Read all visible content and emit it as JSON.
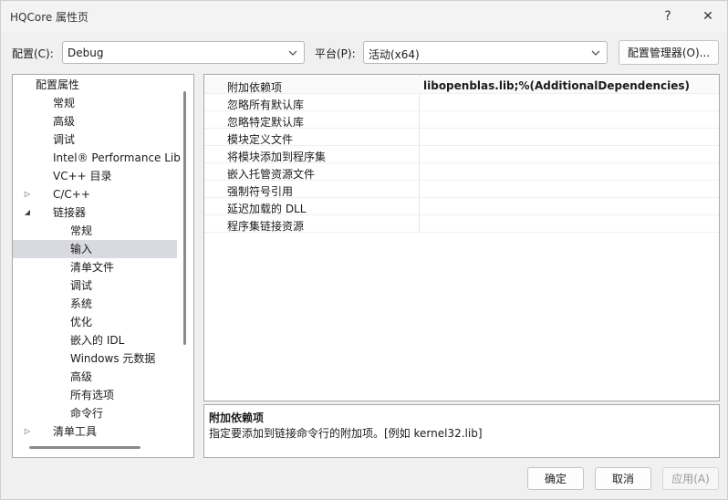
{
  "window": {
    "title": "HQCore 属性页"
  },
  "titlebar": {
    "help_glyph": "?",
    "close_glyph": "✕"
  },
  "config": {
    "label": "配置(C):",
    "value": "Debug",
    "platform_label": "平台(P):",
    "platform_value": "活动(x64)",
    "manager_button": "配置管理器(O)..."
  },
  "tree": {
    "items": [
      {
        "label": "配置属性",
        "expander": "◢"
      },
      {
        "label": "常规"
      },
      {
        "label": "高级"
      },
      {
        "label": "调试"
      },
      {
        "label": "Intel® Performance Lib"
      },
      {
        "label": "VC++ 目录"
      },
      {
        "label": "C/C++",
        "expander": "▷"
      },
      {
        "label": "链接器",
        "expander": "◢"
      },
      {
        "label": "常规"
      },
      {
        "label": "输入"
      },
      {
        "label": "清单文件"
      },
      {
        "label": "调试"
      },
      {
        "label": "系统"
      },
      {
        "label": "优化"
      },
      {
        "label": "嵌入的 IDL"
      },
      {
        "label": "Windows 元数据"
      },
      {
        "label": "高级"
      },
      {
        "label": "所有选项"
      },
      {
        "label": "命令行"
      },
      {
        "label": "清单工具",
        "expander": "▷"
      }
    ],
    "selected_index": 9
  },
  "properties": [
    {
      "name": "附加依赖项",
      "value": "libopenblas.lib;%(AdditionalDependencies)"
    },
    {
      "name": "忽略所有默认库",
      "value": ""
    },
    {
      "name": "忽略特定默认库",
      "value": ""
    },
    {
      "name": "模块定义文件",
      "value": ""
    },
    {
      "name": "将模块添加到程序集",
      "value": ""
    },
    {
      "name": "嵌入托管资源文件",
      "value": ""
    },
    {
      "name": "强制符号引用",
      "value": ""
    },
    {
      "name": "延迟加载的 DLL",
      "value": ""
    },
    {
      "name": "程序集链接资源",
      "value": ""
    }
  ],
  "description": {
    "title": "附加依赖项",
    "text": "指定要添加到链接命令行的附加项。[例如 kernel32.lib]"
  },
  "buttons": {
    "ok": "确定",
    "cancel": "取消",
    "apply": "应用(A)"
  }
}
